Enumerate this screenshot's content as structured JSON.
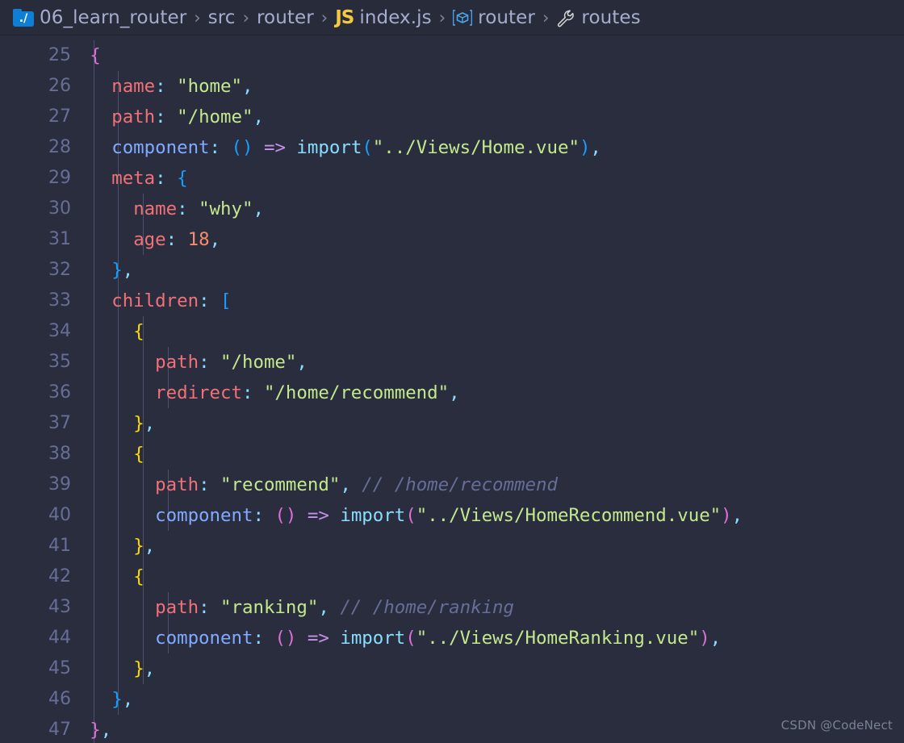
{
  "breadcrumb": {
    "items": [
      {
        "label": "06_learn_router",
        "icon": "folder-root-icon"
      },
      {
        "label": "src",
        "icon": null
      },
      {
        "label": "router",
        "icon": null
      },
      {
        "label": "index.js",
        "icon": "js-file-icon"
      },
      {
        "label": "router",
        "icon": "module-symbol-icon"
      },
      {
        "label": "routes",
        "icon": "property-wrench-icon"
      }
    ],
    "separator": "›"
  },
  "editor": {
    "first_line_number": 25,
    "line_numbers": [
      25,
      26,
      27,
      28,
      29,
      30,
      31,
      32,
      33,
      34,
      35,
      36,
      37,
      38,
      39,
      40,
      41,
      42,
      43,
      44,
      45,
      46,
      47
    ],
    "lines": [
      {
        "n": 25,
        "text": "  {"
      },
      {
        "n": 26,
        "text": "    name: \"home\","
      },
      {
        "n": 27,
        "text": "    path: \"/home\","
      },
      {
        "n": 28,
        "text": "    component: () => import(\"../Views/Home.vue\"),"
      },
      {
        "n": 29,
        "text": "    meta: {"
      },
      {
        "n": 30,
        "text": "      name: \"why\","
      },
      {
        "n": 31,
        "text": "      age: 18,"
      },
      {
        "n": 32,
        "text": "    },"
      },
      {
        "n": 33,
        "text": "    children: ["
      },
      {
        "n": 34,
        "text": "      {"
      },
      {
        "n": 35,
        "text": "        path: \"/home\","
      },
      {
        "n": 36,
        "text": "        redirect: \"/home/recommend\","
      },
      {
        "n": 37,
        "text": "      },"
      },
      {
        "n": 38,
        "text": "      {"
      },
      {
        "n": 39,
        "text": "        path: \"recommend\", // /home/recommend"
      },
      {
        "n": 40,
        "text": "        component: () => import(\"../Views/HomeRecommend.vue\"),"
      },
      {
        "n": 41,
        "text": "      },"
      },
      {
        "n": 42,
        "text": "      {"
      },
      {
        "n": 43,
        "text": "        path: \"ranking\", // /home/ranking"
      },
      {
        "n": 44,
        "text": "        component: () => import(\"../Views/HomeRanking.vue\"),"
      },
      {
        "n": 45,
        "text": "      },"
      },
      {
        "n": 46,
        "text": "    },"
      },
      {
        "n": 47,
        "text": "  },"
      }
    ]
  },
  "watermark": {
    "text": "CSDN @CodeNect"
  },
  "colors": {
    "background": "#292d3e",
    "breadcrumb_bg": "#282c3a",
    "line_number": "#676e95",
    "key": "#f07178",
    "property": "#82aaff",
    "string": "#c3e88d",
    "number": "#f78c6c",
    "operator": "#c792ea",
    "import": "#89ddff",
    "comment": "#676e95",
    "bracket_level_1": "#ffd700",
    "bracket_level_2": "#da70d6",
    "bracket_level_3": "#179fff",
    "indent_guide": "#4b516d",
    "js_yellow": "#f5c842",
    "folder_blue": "#0f7fd6"
  }
}
